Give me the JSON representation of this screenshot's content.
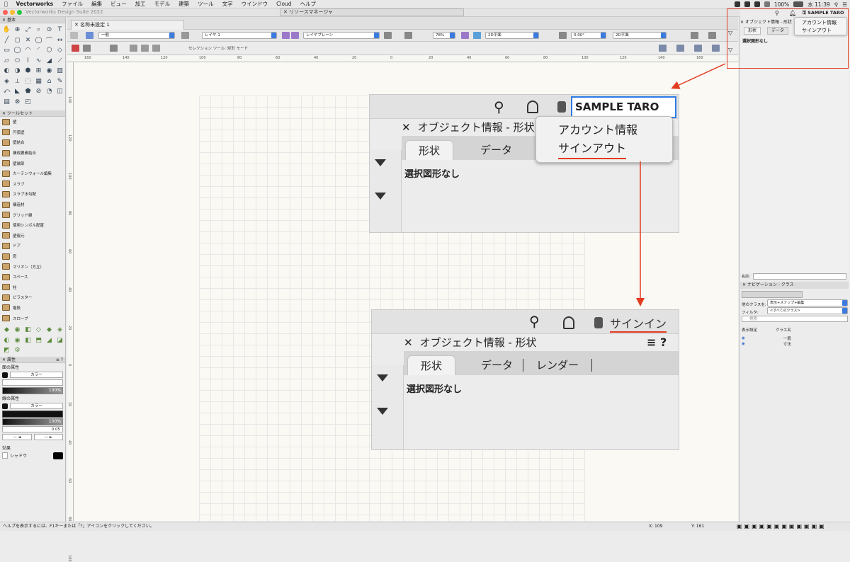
{
  "menubar": {
    "app": "Vectorworks",
    "items": [
      "ファイル",
      "編集",
      "ビュー",
      "加工",
      "モデル",
      "建築",
      "ツール",
      "文字",
      "ウインドウ",
      "Cloud",
      "ヘルプ"
    ],
    "battery": "100%",
    "clock": "水 11:39"
  },
  "titlebar": {
    "title": "Vectorworks Design Suite 2022",
    "resource_manager": "リソースマネージャ"
  },
  "document": {
    "tab": "名称未設定 1"
  },
  "viewbar": {
    "class": "一般",
    "layer": "レイヤ-1",
    "layer_plane": "レイヤプレーン",
    "zoom": "78%",
    "view": "2D平面",
    "rotation": "0.00°",
    "view2": "2D平面"
  },
  "modebar": {
    "text": "セレクション ツール: 矩形 モード"
  },
  "ruler": {
    "h": [
      "160",
      "140",
      "120",
      "100",
      "80",
      "60",
      "40",
      "20",
      "0",
      "20",
      "40",
      "60",
      "80",
      "100",
      "120",
      "140",
      "160"
    ],
    "v": [
      "140",
      "120",
      "100",
      "80",
      "60",
      "40",
      "20",
      "0",
      "20",
      "40",
      "60",
      "80",
      "100"
    ]
  },
  "palette": {
    "basic_title": "基本",
    "toolset_title": "ツールセット",
    "toolset_items": [
      "壁",
      "円弧壁",
      "壁結合",
      "構成要素結合",
      "壁端部",
      "カーテンウォール編集",
      "スラブ",
      "スラブ水勾配",
      "構造材",
      "グリッド線",
      "使用シンボル配置",
      "壁復元",
      "ドア",
      "窓",
      "マリオン（方立）",
      "スペース",
      "柱",
      "ピラスター",
      "階段",
      "スロープ"
    ],
    "attr_title": "属性",
    "fill_label": "面の属性",
    "fill_type": "カラー",
    "fill_opacity": "100%",
    "line_label": "線の属性",
    "line_type": "カラー",
    "line_opacity": "100%",
    "line_weight": "0.05",
    "effects_label": "効果",
    "shadow_label": "シャドウ"
  },
  "right_panel": {
    "oi_title": "オブジェクト情報 - 形状",
    "tabs": [
      "形状",
      "データ"
    ],
    "no_selection": "選択図形なし",
    "name_label": "名前:",
    "user": "SAMPLE TARO",
    "account_menu": [
      "アカウント情報",
      "サインアウト"
    ],
    "nav_title": "ナビゲーション - クラス",
    "other_class_label": "他のクラスを:",
    "other_class_value": "表示+スナップ+編集",
    "filter_label": "フィルタ:",
    "filter_value": "<すべてのクラス>",
    "search_placeholder": "検索",
    "col_visibility": "表示設定",
    "col_class": "クラス名",
    "classes": [
      "一般",
      "寸法"
    ]
  },
  "callout1": {
    "user": "SAMPLE TARO",
    "oi_title": "オブジェクト情報 - 形状",
    "tab1": "形状",
    "tab2": "データ",
    "menu": [
      "アカウント情報",
      "サインアウト"
    ],
    "no_selection": "選択図形なし"
  },
  "callout2": {
    "sign_in": "サインイン",
    "oi_title": "オブジェクト情報 - 形状",
    "tabs": [
      "形状",
      "データ",
      "レンダー"
    ],
    "no_selection": "選択図形なし"
  },
  "status": {
    "help": "ヘルプを表示するには、F1キーまたは「?」アイコンをクリックしてください。",
    "x": "X: 109",
    "y": "Y: 161"
  },
  "colors": {
    "accent_red": "#e23b20",
    "select_blue": "#2f7ae5"
  }
}
